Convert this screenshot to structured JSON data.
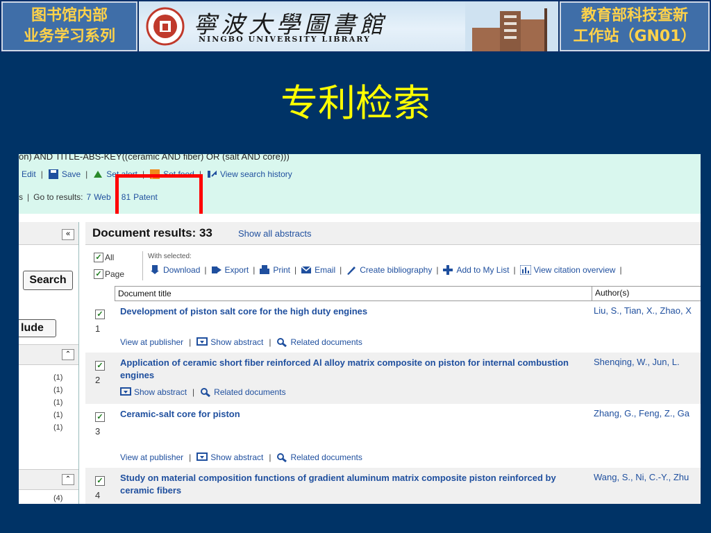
{
  "header": {
    "left_line1": "图书馆内部",
    "left_line2": "业务学习系列",
    "library_cn": "寧波大學圖書館",
    "library_en": "NINGBO UNIVERSITY LIBRARY",
    "right_line1": "教育部科技查新",
    "right_line2": "工作站（GN01）"
  },
  "slide_title": "专利检索",
  "screenshot": {
    "query_text": "on) AND TITLE-ABS-KEY((ceramic AND fiber) OR (salt AND core)))",
    "actions": {
      "edit": "Edit",
      "save": "Save",
      "set_alert": "Set alert",
      "set_feed": "Set feed",
      "history": "View search history"
    },
    "goto": {
      "prefix": "s",
      "label": "Go to results:",
      "web_count": "7",
      "web": "Web",
      "patent_count": "81",
      "patent": "Patent"
    },
    "left_panel": {
      "collapse": "«",
      "search_button": "Search",
      "exclude_button": "lude",
      "section_toggle": "⌃",
      "counts": [
        "(1)",
        "(1)",
        "(1)",
        "(1)",
        "(1)"
      ],
      "count_bottom": "(4)"
    },
    "results": {
      "title": "Document results: 33",
      "show_all": "Show all abstracts",
      "select_all": "All",
      "select_page": "Page",
      "with_selected": "With selected:",
      "tools": {
        "download": "Download",
        "export": "Export",
        "print": "Print",
        "email": "Email",
        "bibliography": "Create bibliography",
        "add_list": "Add to My List",
        "citation": "View citation overview"
      },
      "col_title": "Document title",
      "col_author": "Author(s)",
      "view_publisher": "View at publisher",
      "show_abstract": "Show abstract",
      "related": "Related documents",
      "items": [
        {
          "num": "1",
          "title": "Development of piston salt core for the high duty engines",
          "authors": "Liu, S., Tian, X., Zhao, X"
        },
        {
          "num": "2",
          "title": "Application of ceramic short fiber reinforced Al alloy matrix composite on piston for internal combustion engines",
          "authors": "Shenqing, W., Jun, L."
        },
        {
          "num": "3",
          "title": "Ceramic-salt core for piston",
          "authors": "Zhang, G., Feng, Z., Ga"
        },
        {
          "num": "4",
          "title": "Study on material composition functions of gradient aluminum matrix composite piston reinforced by ceramic fibers",
          "authors": "Wang, S., Ni, C.-Y., Zhu"
        }
      ]
    }
  },
  "colors": {
    "background": "#003366",
    "title_yellow": "#ffff00",
    "header_gold": "#ffd24a",
    "query_bg": "#d9f7ee",
    "link_blue": "#1f4f9e",
    "highlight_red": "#ff0000"
  }
}
